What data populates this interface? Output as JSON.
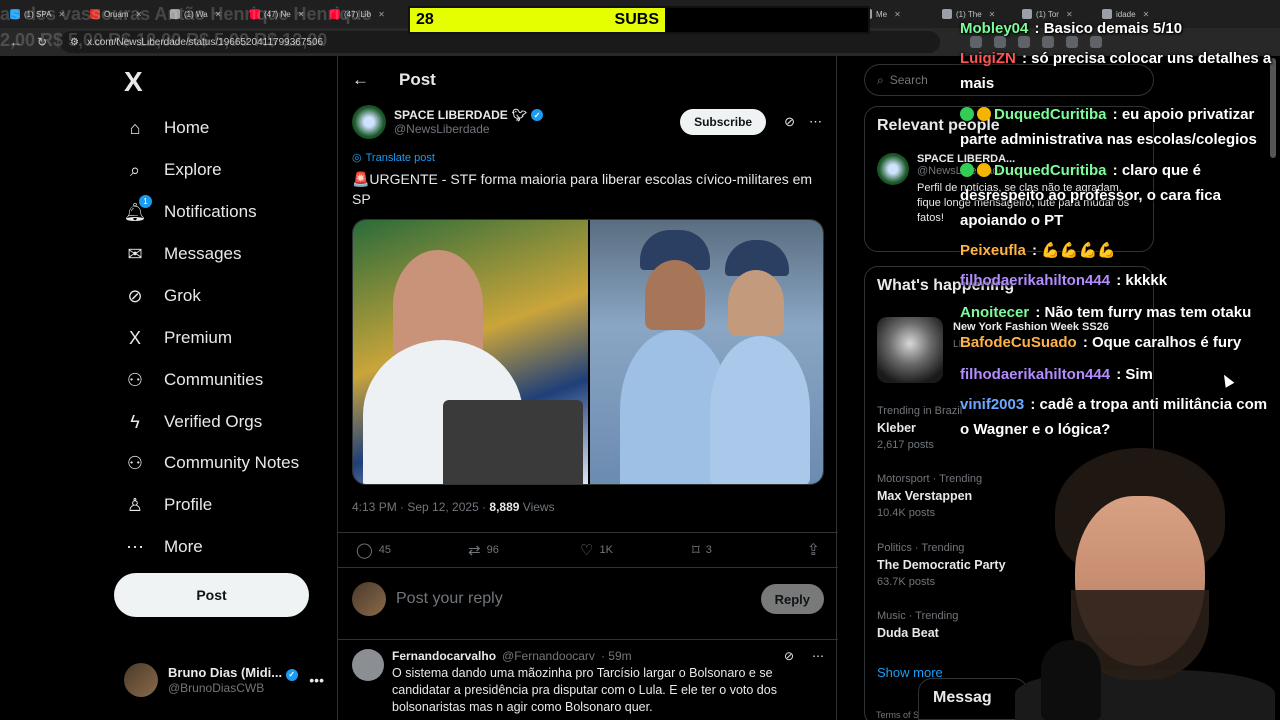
{
  "browser": {
    "tabs": [
      "(1) SPA",
      "Oruam",
      "(1) Wa",
      "(47) Ne",
      "(47) Lib",
      "Quem",
      "(1) Tim",
      "Me",
      "(1) The",
      "(1) Tor",
      "idade"
    ],
    "url": "x.com/NewsLiberdade/status/1966520411799367506",
    "ghost_text_1": "as des vassouras   Antão   Henrique   Henrique",
    "ghost_text_2": "2,00       R$ 5,00       R$ 12,00   R$ 5,00       R$ 12,00"
  },
  "subs_overlay": {
    "count": "28",
    "label": "SUBS"
  },
  "nav": {
    "logo": "X",
    "items": [
      {
        "label": "Home",
        "icon": "home-icon",
        "glyph": "⌂"
      },
      {
        "label": "Explore",
        "icon": "search-icon",
        "glyph": "⌕"
      },
      {
        "label": "Notifications",
        "icon": "bell-icon",
        "glyph": "🔔︎",
        "badge": "1"
      },
      {
        "label": "Messages",
        "icon": "mail-icon",
        "glyph": "✉"
      },
      {
        "label": "Grok",
        "icon": "grok-icon",
        "glyph": "⊘"
      },
      {
        "label": "Premium",
        "icon": "x-icon",
        "glyph": "X"
      },
      {
        "label": "Communities",
        "icon": "people-icon",
        "glyph": "⚇"
      },
      {
        "label": "Verified Orgs",
        "icon": "lightning-icon",
        "glyph": "ϟ"
      },
      {
        "label": "Community Notes",
        "icon": "notes-icon",
        "glyph": "⚇"
      },
      {
        "label": "Profile",
        "icon": "profile-icon",
        "glyph": "♙"
      },
      {
        "label": "More",
        "icon": "more-icon",
        "glyph": "⋯"
      }
    ],
    "post_button": "Post",
    "me": {
      "name": "Bruno Dias (Midi...",
      "handle": "@BrunoDiasCWB"
    }
  },
  "post": {
    "header": "Post",
    "author_name": "SPACE LIBERDADE",
    "author_handle": "@NewsLiberdade",
    "subscribe": "Subscribe",
    "translate": "Translate post",
    "text": "🚨URGENTE - STF forma maioria para liberar escolas cívico-militares em SP",
    "time": "4:13 PM · Sep 12, 2025 · ",
    "views_count": "8,889",
    "views_label": " Views",
    "actions": {
      "replies": "45",
      "reposts": "96",
      "likes": "1K",
      "bookmarks": "3"
    },
    "reply_placeholder": "Post your reply",
    "reply_button": "Reply"
  },
  "comment": {
    "name": "Fernandocarvalho",
    "handle": "@Fernandoocarv",
    "time": "· 59m",
    "text": "O sistema dando uma mãozinha pro Tarcísio largar o Bolsonaro e se candidatar a presidência pra disputar com o Lula. E ele ter o voto dos bolsonaristas mas n agir como Bolsonaro quer."
  },
  "right": {
    "search_placeholder": "Search",
    "relevant_title": "Relevant people",
    "relevant": {
      "name": "SPACE LIBERDA...",
      "handle": "@NewsLiberdade",
      "bio": "Perfil de notícias, se clas não te agradam, fique longe mensageiro, lute para mudar os fatos!"
    },
    "happening_title": "What's happening",
    "featured": {
      "title": "New York Fashion Week SS26",
      "sub": "LIVE"
    },
    "trends": [
      {
        "context": "Trending in Brazil",
        "title": "Kleber",
        "posts": "2,617 posts"
      },
      {
        "context": "Motorsport · Trending",
        "title": "Max Verstappen",
        "posts": "10.4K posts"
      },
      {
        "context": "Politics · Trending",
        "title": "The Democratic Party",
        "posts": "63.7K posts"
      },
      {
        "context": "Music · Trending",
        "title": "Duda Beat",
        "posts": ""
      }
    ],
    "show_more": "Show more",
    "terms": "Terms of S",
    "messages": "Messag"
  },
  "chat": [
    {
      "user": "Mobley04",
      "text": " : Basico demais 5/10",
      "color": "#7CFC9A"
    },
    {
      "user": "LuigiZN",
      "text": " : só precisa colocar uns detalhes a mais",
      "color": "#FF5555"
    },
    {
      "user": "DuquedCuritiba",
      "text": " : eu apoio privatizar parte administrativa nas escolas/colegios",
      "color": "#7CFC9A",
      "badge": true
    },
    {
      "user": "DuquedCuritiba",
      "text": " : claro que é desrespeito ao professor, o cara fica apoiando o PT",
      "color": "#7CFC9A",
      "badge": true
    },
    {
      "user": "Peixeufla",
      "text": " : 💪💪💪💪",
      "color": "#FFB347"
    },
    {
      "user": "filhodaerikahilton444",
      "text": " : kkkkk",
      "color": "#B48CFF"
    },
    {
      "user": "Anoitecer",
      "text": " : Não tem furry mas tem otaku",
      "color": "#7CFC9A"
    },
    {
      "user": "BafodeCuSuado",
      "text": " : Oque caralhos é fury",
      "color": "#FFB347"
    },
    {
      "user": "filhodaerikahilton444",
      "text": " : Sim",
      "color": "#B48CFF"
    },
    {
      "user": "vinif2003",
      "text": " : cadê a tropa anti militância com o Wagner e o lógica?",
      "color": "#6CA8FF"
    }
  ]
}
